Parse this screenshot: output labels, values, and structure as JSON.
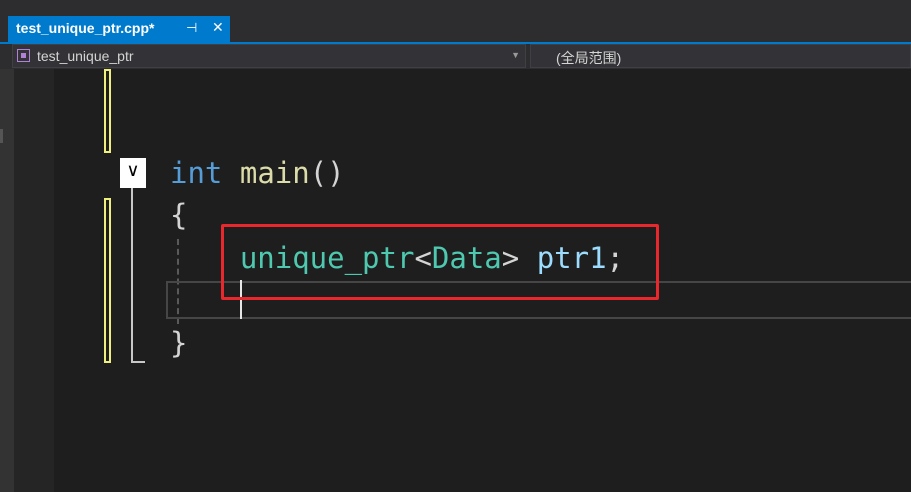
{
  "tab": {
    "title": "test_unique_ptr.cpp*",
    "pin_glyph": "⊣",
    "close_glyph": "✕"
  },
  "navbar": {
    "left_icon": "class-icon",
    "left_label": "test_unique_ptr",
    "left_dropdown_glyph": "▼",
    "right_label": "(全局范围)"
  },
  "editor": {
    "fold_glyph": "∨",
    "lines": [
      {
        "keyword": "int",
        "func": "main",
        "parens": "()"
      },
      {
        "brace": "{"
      },
      {
        "type": "unique_ptr",
        "lt": "<",
        "type_arg": "Data",
        "gt": ">",
        "var": "ptr1",
        "semi": ";"
      },
      {
        "brace": "}"
      }
    ]
  },
  "colors": {
    "accent": "#007acc",
    "highlight": "#e8282d",
    "change_bar": "#efef7e",
    "keyword": "#569cd6",
    "function": "#dcdcaa",
    "type": "#4ec9b0",
    "variable": "#9cdcfe"
  }
}
